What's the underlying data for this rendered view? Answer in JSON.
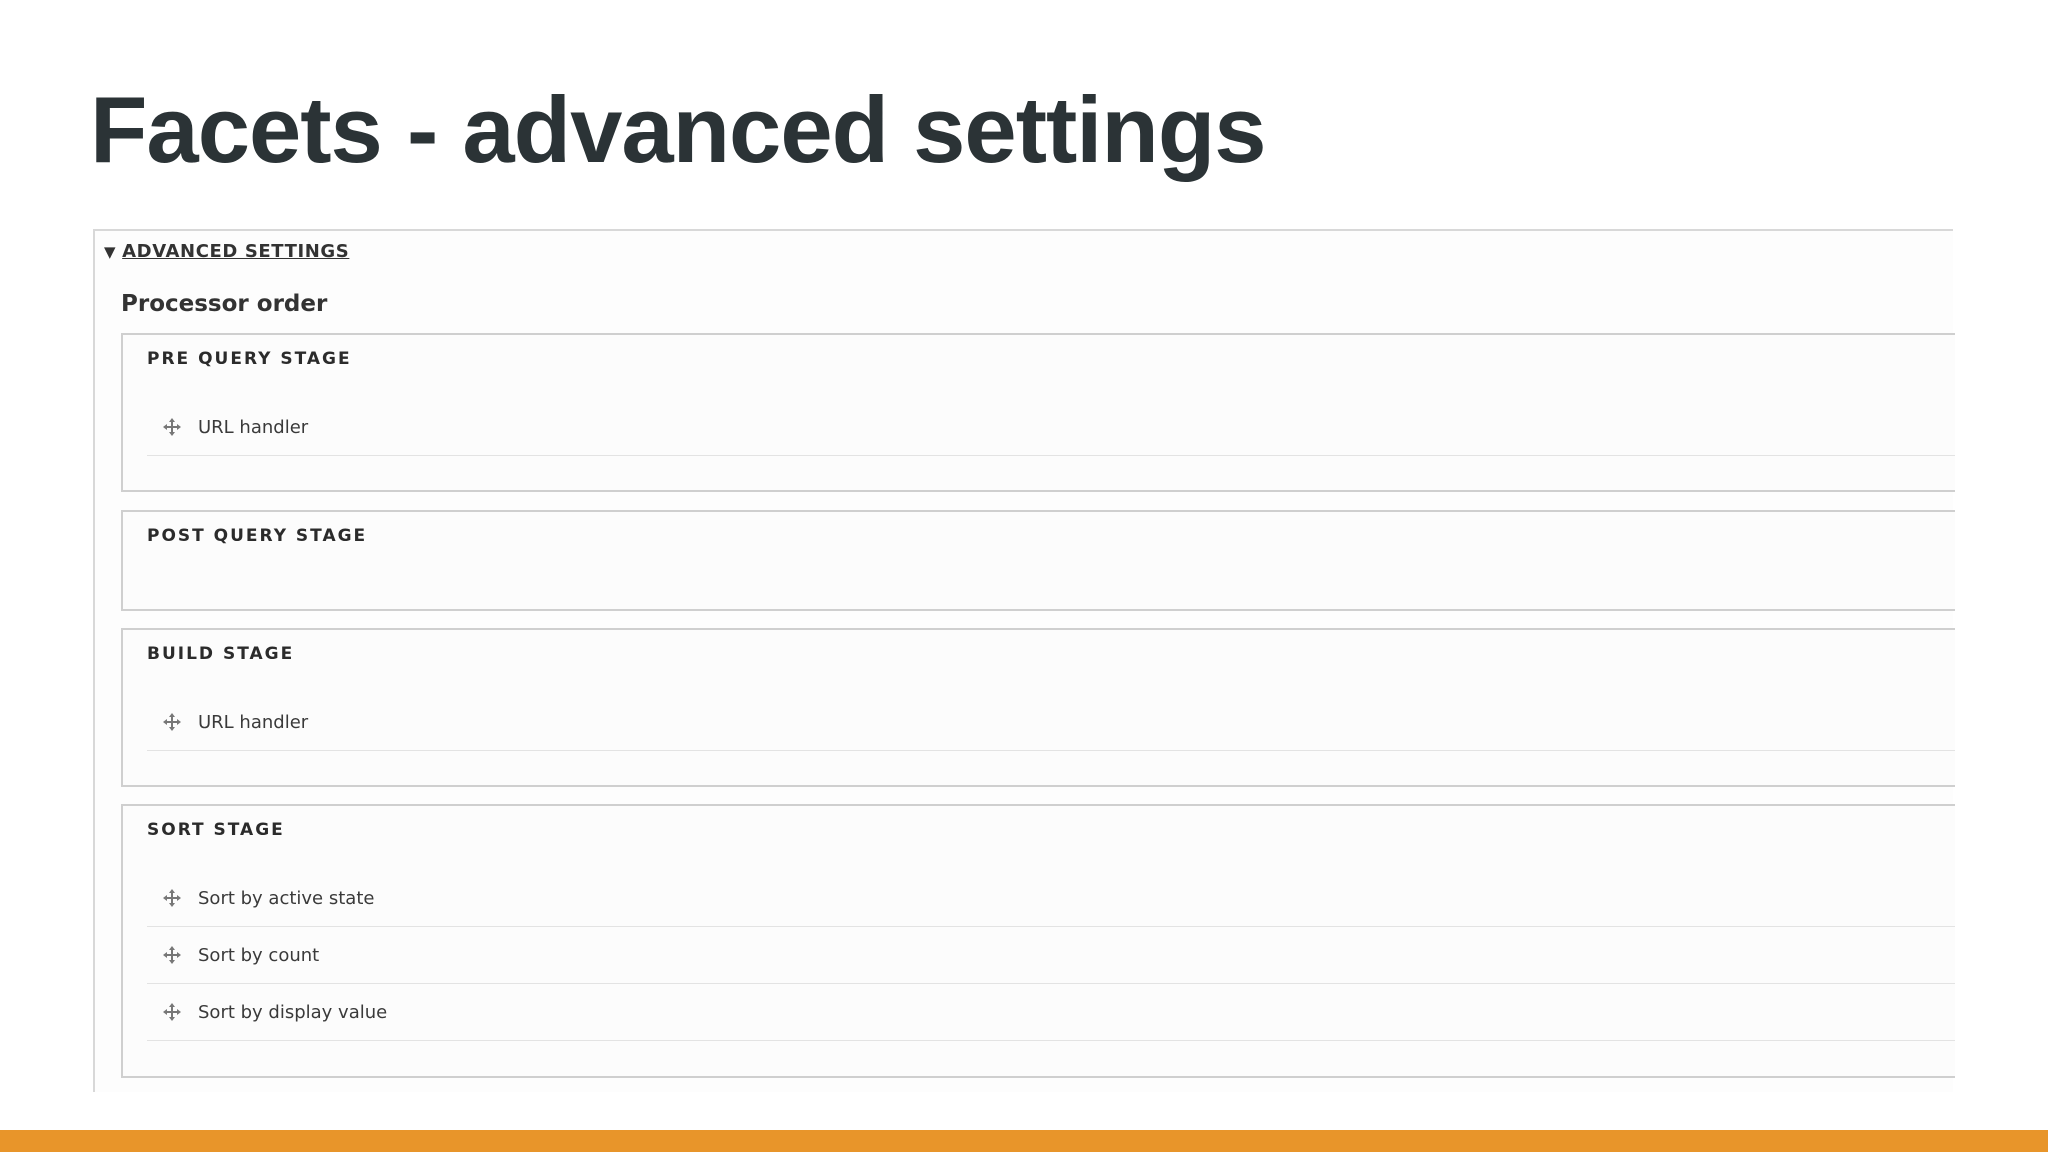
{
  "slide": {
    "title": "Facets - advanced settings"
  },
  "details": {
    "summary_label": "Advanced settings",
    "processor_order_label": "Processor order"
  },
  "stages": [
    {
      "title": "PRE QUERY STAGE",
      "items": [
        "URL handler"
      ]
    },
    {
      "title": "POST QUERY STAGE",
      "items": []
    },
    {
      "title": "BUILD STAGE",
      "items": [
        "URL handler"
      ]
    },
    {
      "title": "SORT STAGE",
      "items": [
        "Sort by active state",
        "Sort by count",
        "Sort by display value"
      ]
    }
  ],
  "colors": {
    "title": "#2b3336",
    "footer_bar": "#e8952a",
    "border": "#cfcfcf"
  },
  "icons": {
    "drag_handle": "move-arrows-icon",
    "summary_toggle": "caret-down-icon"
  }
}
